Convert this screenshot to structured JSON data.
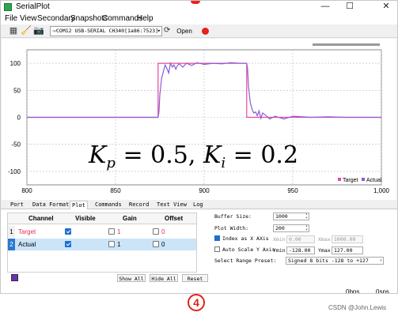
{
  "window": {
    "title": "SerialPlot",
    "min_glyph": "—",
    "max_glyph": "☐",
    "close_glyph": "✕"
  },
  "menu": {
    "items": [
      "File",
      "View",
      "Secondary",
      "Snapshots",
      "Commands",
      "Help"
    ]
  },
  "toolbar": {
    "port_value": "~⁄COM12 USB-SERIAL CH340[1a86:7523]",
    "refresh_glyph": "⟳",
    "open_label": "Open"
  },
  "plot": {
    "formula_kp_label": "K",
    "formula_kp_sub": "p",
    "formula_kp_value": " = 0.5, ",
    "formula_ki_label": "K",
    "formula_ki_sub": "i",
    "formula_ki_value": " = 0.2"
  },
  "chart_data": {
    "type": "line",
    "title": "",
    "xlabel": "",
    "ylabel": "",
    "xlim": [
      800,
      1000
    ],
    "ylim": [
      -125,
      125
    ],
    "x_ticks": [
      "800",
      "850",
      "900",
      "950",
      "1,000"
    ],
    "y_ticks": [
      "100",
      "50",
      "0",
      "-50",
      "-100"
    ],
    "grid": true,
    "legend_position": "bottom-right",
    "series": [
      {
        "name": "Target",
        "color": "#e8479a",
        "x": [
          800,
          874,
          874,
          924,
          924,
          1000
        ],
        "y": [
          0,
          0,
          100,
          100,
          0,
          0
        ]
      },
      {
        "name": "Actual",
        "color": "#8a5cd6",
        "x": [
          800,
          874,
          874.5,
          875,
          876,
          877,
          878,
          879,
          880,
          881,
          882,
          883,
          884,
          885,
          886,
          888,
          890,
          893,
          896,
          900,
          905,
          910,
          915,
          920,
          924,
          924.5,
          925,
          926,
          927,
          928,
          929,
          930,
          931,
          932,
          933,
          935,
          937,
          940,
          945,
          950,
          960,
          970,
          980,
          1000
        ],
        "y": [
          0,
          0,
          10,
          42,
          72,
          85,
          97,
          90,
          82,
          100,
          93,
          97,
          89,
          96,
          99,
          93,
          100,
          96,
          101,
          98,
          100,
          99,
          101,
          100,
          100,
          90,
          58,
          28,
          15,
          8,
          10,
          3,
          12,
          -2,
          8,
          3,
          -3,
          2,
          -3,
          2,
          0,
          1,
          0,
          0
        ]
      }
    ]
  },
  "tabs": [
    "Port",
    "Data Format",
    "Plot",
    "Commands",
    "Record",
    "Text View",
    "Log"
  ],
  "channels": {
    "headers": [
      "Channel",
      "Visible",
      "Gain",
      "Offset"
    ],
    "rows": [
      {
        "num": "1",
        "name": "Target",
        "visible": true,
        "gain": "1",
        "offset": "0",
        "color": "#e0304a"
      },
      {
        "num": "2",
        "name": "Actual",
        "visible": true,
        "gain": "1",
        "offset": "0",
        "color": "#000000"
      }
    ],
    "swatch_color": "#6a2fb5",
    "show_all_label": "Show All",
    "hide_all_label": "Hide All",
    "reset_label": "Reset"
  },
  "settings": {
    "buffer_size_label": "Buffer Size:",
    "buffer_size_value": "1000",
    "plot_width_label": "Plot Width:",
    "plot_width_value": "200",
    "index_label": "Index as X AXis",
    "index_checked": true,
    "xmin_label": "Xmin",
    "xmin_value": "0.00",
    "xmax_label": "Xmax",
    "xmax_value": "1000.00",
    "autoscale_label": "Auto Scale Y Axis",
    "autoscale_checked": false,
    "ymin_label": "Ymin",
    "ymin_value": "-128.00",
    "ymax_label": "Ymax",
    "ymax_value": "127.00",
    "range_preset_label": "Select Range Preset:",
    "range_preset_value": "Signed 8 bits -128 to +127"
  },
  "status": {
    "rate_bps": "0bps",
    "rate_sps": "0sps"
  },
  "footer": {
    "marker": "4",
    "watermark": "CSDN @John.Lewis"
  }
}
